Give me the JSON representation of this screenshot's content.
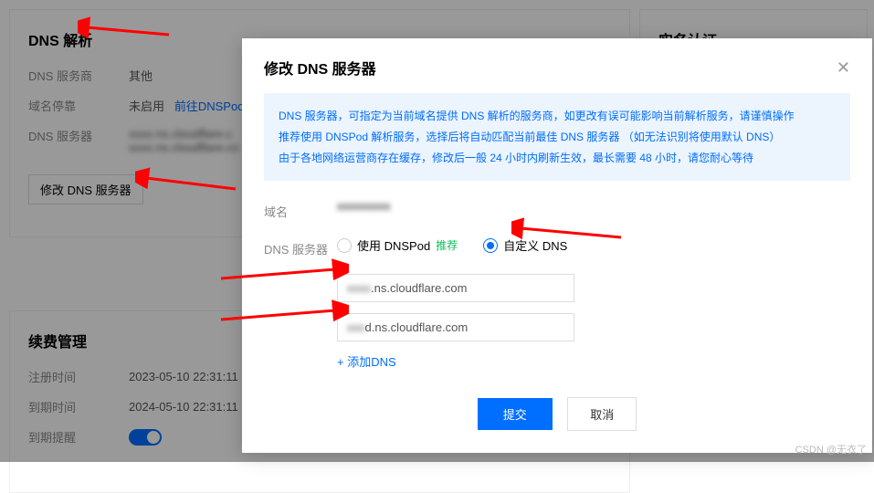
{
  "bg": {
    "dns_panel": {
      "title": "DNS 解析",
      "provider_label": "DNS 服务商",
      "provider_value": "其他",
      "pause_label": "域名停靠",
      "pause_value": "未启用",
      "pause_link": "前往DNSPod",
      "server_label": "DNS 服务器",
      "server_v1": "xxxx.ns.cloudflare.c",
      "server_v2": "xxxx.ns.cloudflare.co",
      "modify_btn": "修改 DNS 服务器"
    },
    "renew_panel": {
      "title": "续费管理",
      "reg_label": "注册时间",
      "reg_value": "2023-05-10 22:31:11",
      "exp_label": "到期时间",
      "exp_value": "2024-05-10 22:31:11",
      "remind_label": "到期提醒"
    },
    "right_title": "实名认证"
  },
  "modal": {
    "title": "修改 DNS 服务器",
    "info_l1": "DNS 服务器，可指定为当前域名提供 DNS 解析的服务商，如更改有误可能影响当前解析服务，请谨慎操作",
    "info_l2": "推荐使用 DNSPod 解析服务，选择后将自动匹配当前最佳 DNS 服务器 （如无法识别将使用默认 DNS）",
    "info_l3": "由于各地网络运营商存在缓存，修改后一般 24 小时内刷新生效，最长需要 48 小时，请您耐心等待",
    "domain_label": "域名",
    "domain_value": "xxxxxxxxx",
    "dns_label": "DNS 服务器",
    "opt_dnspod": "使用 DNSPod",
    "opt_recommend": "推荐",
    "opt_custom": "自定义 DNS",
    "dns1_suffix": ".ns.cloudflare.com",
    "dns1_prefix": "xxxx",
    "dns2_suffix": "d.ns.cloudflare.com",
    "dns2_prefix": "xxx",
    "add_dns": "添加DNS",
    "submit": "提交",
    "cancel": "取消"
  },
  "watermark": "CSDN @无衣了"
}
